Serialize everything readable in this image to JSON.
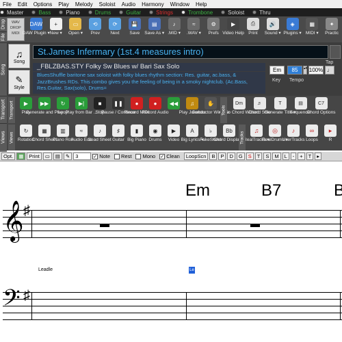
{
  "menu": [
    "File",
    "Edit",
    "Options",
    "Play",
    "Melody",
    "Soloist",
    "Audio",
    "Harmony",
    "Window",
    "Help"
  ],
  "tracks": [
    {
      "label": "Master",
      "color": "#dddddd",
      "on": true
    },
    {
      "label": "Bass",
      "color": "#3cb043",
      "on": false
    },
    {
      "label": "Piano",
      "color": "#dddddd",
      "on": false
    },
    {
      "label": "Drums",
      "color": "#3cb043",
      "on": false
    },
    {
      "label": "Guitar",
      "color": "#3cb043",
      "on": false
    },
    {
      "label": "Strings",
      "color": "#e03030",
      "on": false
    },
    {
      "label": "Trombone",
      "color": "#3cb043",
      "on": true
    },
    {
      "label": "Soloist",
      "color": "#dddddd",
      "on": false
    },
    {
      "label": "Thru",
      "color": "#dddddd",
      "on": false
    }
  ],
  "drawer_labels": {
    "drop": "Drop",
    "file": "File",
    "song": "Song",
    "transport": "Transport",
    "views": "Views",
    "tools": "Tools",
    "tracks": "Tracks"
  },
  "toolbar1": [
    {
      "name": "wav-drop",
      "label": "DAW Plugin ▾",
      "icon": "DAW"
    },
    {
      "name": "new",
      "label": "New ▾",
      "icon": "+"
    },
    {
      "name": "open",
      "label": "Open ▾",
      "icon": "▭"
    },
    {
      "name": "prev",
      "label": "Prev",
      "icon": "⟲"
    },
    {
      "name": "next",
      "label": "Next",
      "icon": "⟳"
    },
    {
      "name": "save",
      "label": "Save",
      "icon": "💾"
    },
    {
      "name": "save-as",
      "label": "Save As ▾",
      "icon": "▤"
    },
    {
      "name": "mid",
      "label": ".MID ▾",
      "icon": "♪"
    },
    {
      "name": "wav",
      "label": ".WAV ▾",
      "icon": "≈"
    },
    {
      "name": "prefs",
      "label": "Prefs",
      "icon": "⚙"
    },
    {
      "name": "video-help",
      "label": "Video Help",
      "icon": "▶"
    },
    {
      "name": "print",
      "label": "Print",
      "icon": "⎙"
    },
    {
      "name": "sound",
      "label": "Sound ▾",
      "icon": "🔊"
    },
    {
      "name": "plugins",
      "label": "Plugins ▾",
      "icon": "◈"
    },
    {
      "name": "midi",
      "label": "MIDI ▾",
      "icon": "▦"
    },
    {
      "name": "practice",
      "label": "Practic",
      "icon": "✦"
    }
  ],
  "song": {
    "song_button": "Song",
    "style_button": "Style",
    "title": "St.James Infermary (1st.4 measures intro)",
    "style_name": "_FBLZBAS.STY Folky Sw Blues w/ Bari Sax Solo",
    "style_desc": "BluesShuffle baritone sax soloist with folky blues rhythm section:  Res. guitar, ac.bass, & JazzBrushes RDs.  This combo gives you the feeling of being in a smoky nightclub.     (Ac.Bass, Res.Guitar, Sax(solo), Drums=",
    "key": "Em",
    "tempo": "85",
    "zoom": "100%",
    "tap_label": "Tap",
    "key_label": "Key",
    "tempo_label": "Tempo"
  },
  "transport": [
    {
      "name": "play",
      "label": "Play",
      "icon": "▶",
      "color": "#2a9d3a"
    },
    {
      "name": "generate-play",
      "label": "Generate and Play",
      "icon": "▶▶",
      "color": "#2a9d3a"
    },
    {
      "name": "loop",
      "label": "Loop",
      "icon": "↻",
      "color": "#2a9d3a"
    },
    {
      "name": "play-from-bar",
      "label": "Play from Bar ...",
      "icon": "▶|",
      "color": "#2a9d3a"
    },
    {
      "name": "stop",
      "label": "Stop",
      "icon": "■",
      "color": "#222222"
    },
    {
      "name": "pause",
      "label": "Pause / Continue",
      "icon": "❚❚",
      "color": "#333333"
    },
    {
      "name": "record-midi",
      "label": "Record MIDI",
      "icon": "●",
      "color": "#d02020"
    },
    {
      "name": "record-audio",
      "label": "Record Audio",
      "icon": "●",
      "color": "#d02020"
    },
    {
      "name": "rewind",
      "label": "",
      "icon": "◀◀",
      "color": "#2a9d3a"
    },
    {
      "name": "play-jukebox",
      "label": "Play Jukebox",
      "icon": "♫",
      "color": "#c08a10"
    },
    {
      "name": "conductor",
      "label": "Conductor Window",
      "icon": "✋",
      "color": "#555555"
    }
  ],
  "tools": [
    {
      "name": "audio-chord-wizard",
      "label": "Audio Chord Wizard",
      "icon": "Dm"
    },
    {
      "name": "chord-solo",
      "label": "Chord Solo",
      "icon": "♬"
    },
    {
      "name": "generate-title",
      "label": "Generate Title ▾",
      "icon": "T"
    },
    {
      "name": "sequencer",
      "label": "Sequencer",
      "icon": "▤"
    },
    {
      "name": "chord-options",
      "label": "Chord Options",
      "icon": "C7"
    }
  ],
  "views": [
    {
      "name": "rotation",
      "label": "Rotation",
      "icon": "↻"
    },
    {
      "name": "chord-sheet",
      "label": "Chord Sheet",
      "icon": "▦"
    },
    {
      "name": "piano-roll",
      "label": "Piano Roll",
      "icon": "▥"
    },
    {
      "name": "audio-edit",
      "label": "Audio Edit",
      "icon": "≈"
    },
    {
      "name": "lead-sheet",
      "label": "Lead Sheet",
      "icon": "♪"
    },
    {
      "name": "guitar",
      "label": "Guitar",
      "icon": "♯"
    },
    {
      "name": "big-piano",
      "label": "Big Piano",
      "icon": "▮"
    },
    {
      "name": "drums",
      "label": "Drums",
      "icon": "◉"
    },
    {
      "name": "video",
      "label": "Video",
      "icon": "▶"
    },
    {
      "name": "big-lyrics",
      "label": "Big Lyrics ▾",
      "icon": "A"
    },
    {
      "name": "fakesheet",
      "label": "FakeSheet",
      "icon": "♭"
    },
    {
      "name": "chord-display",
      "label": "Chord Display ▾",
      "icon": "Bb"
    }
  ],
  "tracks_tools": [
    {
      "name": "realtracks",
      "label": "RealTracks ▾",
      "icon": "♫"
    },
    {
      "name": "realdrums",
      "label": "RealDrums ▾",
      "icon": "◎"
    },
    {
      "name": "usertracks",
      "label": "UserTracks",
      "icon": "♪"
    },
    {
      "name": "loops",
      "label": "Loops",
      "icon": "∞"
    },
    {
      "name": "more",
      "label": "R",
      "icon": "▸"
    }
  ],
  "options_bar": {
    "opt": "Opt.",
    "print": "Print",
    "measure": "3",
    "note": "Note",
    "rest": "Rest",
    "mono": "Mono",
    "clean": "Clean",
    "loopscn": "LoopScn",
    "tracks": [
      "B",
      "P",
      "D",
      "G",
      "S",
      "T",
      "S",
      "M"
    ],
    "l": "L",
    "minus": "-",
    "plus": "+",
    "t": "T"
  },
  "notation": {
    "chords": [
      "Em",
      "B7",
      "B"
    ],
    "lyric": "Leadle",
    "highlight": "Le"
  },
  "colors": {
    "accent": "#49b2f0",
    "toolbar": "#464646",
    "track_bar": "#1e1e1e"
  }
}
